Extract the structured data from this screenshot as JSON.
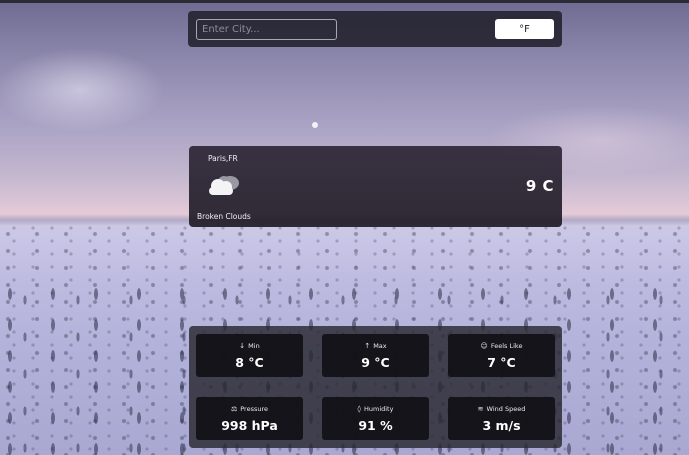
{
  "search": {
    "placeholder": "Enter City..."
  },
  "unit_toggle": {
    "label": "°F"
  },
  "current": {
    "location": "Paris,FR",
    "icon": "broken-clouds-icon",
    "condition": "Broken Clouds",
    "temperature": "9 C"
  },
  "details": [
    {
      "label": "Min",
      "value": "8 °C",
      "icon": "arrow-down-icon",
      "glyph": "↓"
    },
    {
      "label": "Max",
      "value": "9 °C",
      "icon": "arrow-up-icon",
      "glyph": "↑"
    },
    {
      "label": "Feels Like",
      "value": "7 °C",
      "icon": "face-icon",
      "glyph": "☺"
    },
    {
      "label": "Pressure",
      "value": "998 hPa",
      "icon": "pressure-icon",
      "glyph": "⚖"
    },
    {
      "label": "Humidity",
      "value": "91 %",
      "icon": "droplet-icon",
      "glyph": "◊"
    },
    {
      "label": "Wind Speed",
      "value": "3 m/s",
      "icon": "wind-icon",
      "glyph": "≋"
    }
  ]
}
